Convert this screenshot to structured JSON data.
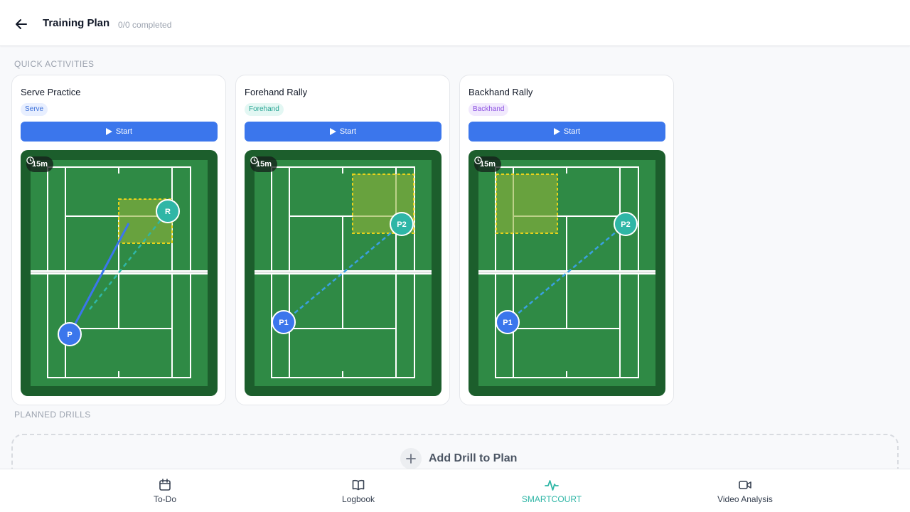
{
  "header": {
    "title": "Training Plan",
    "progress_text": "0/0 completed"
  },
  "sections": {
    "quick": "QUICK ACTIVITIES",
    "planned": "PLANNED DRILLS"
  },
  "cards": [
    {
      "title": "Serve Practice",
      "tag": "Serve",
      "start_label": "Start",
      "duration": "15m",
      "players": [
        "P",
        "R"
      ]
    },
    {
      "title": "Forehand Rally",
      "tag": "Forehand",
      "start_label": "Start",
      "duration": "15m",
      "players": [
        "P1",
        "P2"
      ]
    },
    {
      "title": "Backhand Rally",
      "tag": "Backhand",
      "start_label": "Start",
      "duration": "15m",
      "players": [
        "P1",
        "P2"
      ]
    }
  ],
  "add_drill": {
    "label": "Add Drill to Plan"
  },
  "nav": [
    {
      "label": "To-Do",
      "icon": "calendar-icon"
    },
    {
      "label": "Logbook",
      "icon": "book-icon"
    },
    {
      "label": "SMARTCOURT",
      "icon": "activity-icon",
      "active": true
    },
    {
      "label": "Video Analysis",
      "icon": "video-icon"
    }
  ],
  "colors": {
    "accent": "#3b76ec",
    "active_nav": "#2fb6a6",
    "court": "#2f8a45",
    "court_border": "#1c5e2c"
  }
}
